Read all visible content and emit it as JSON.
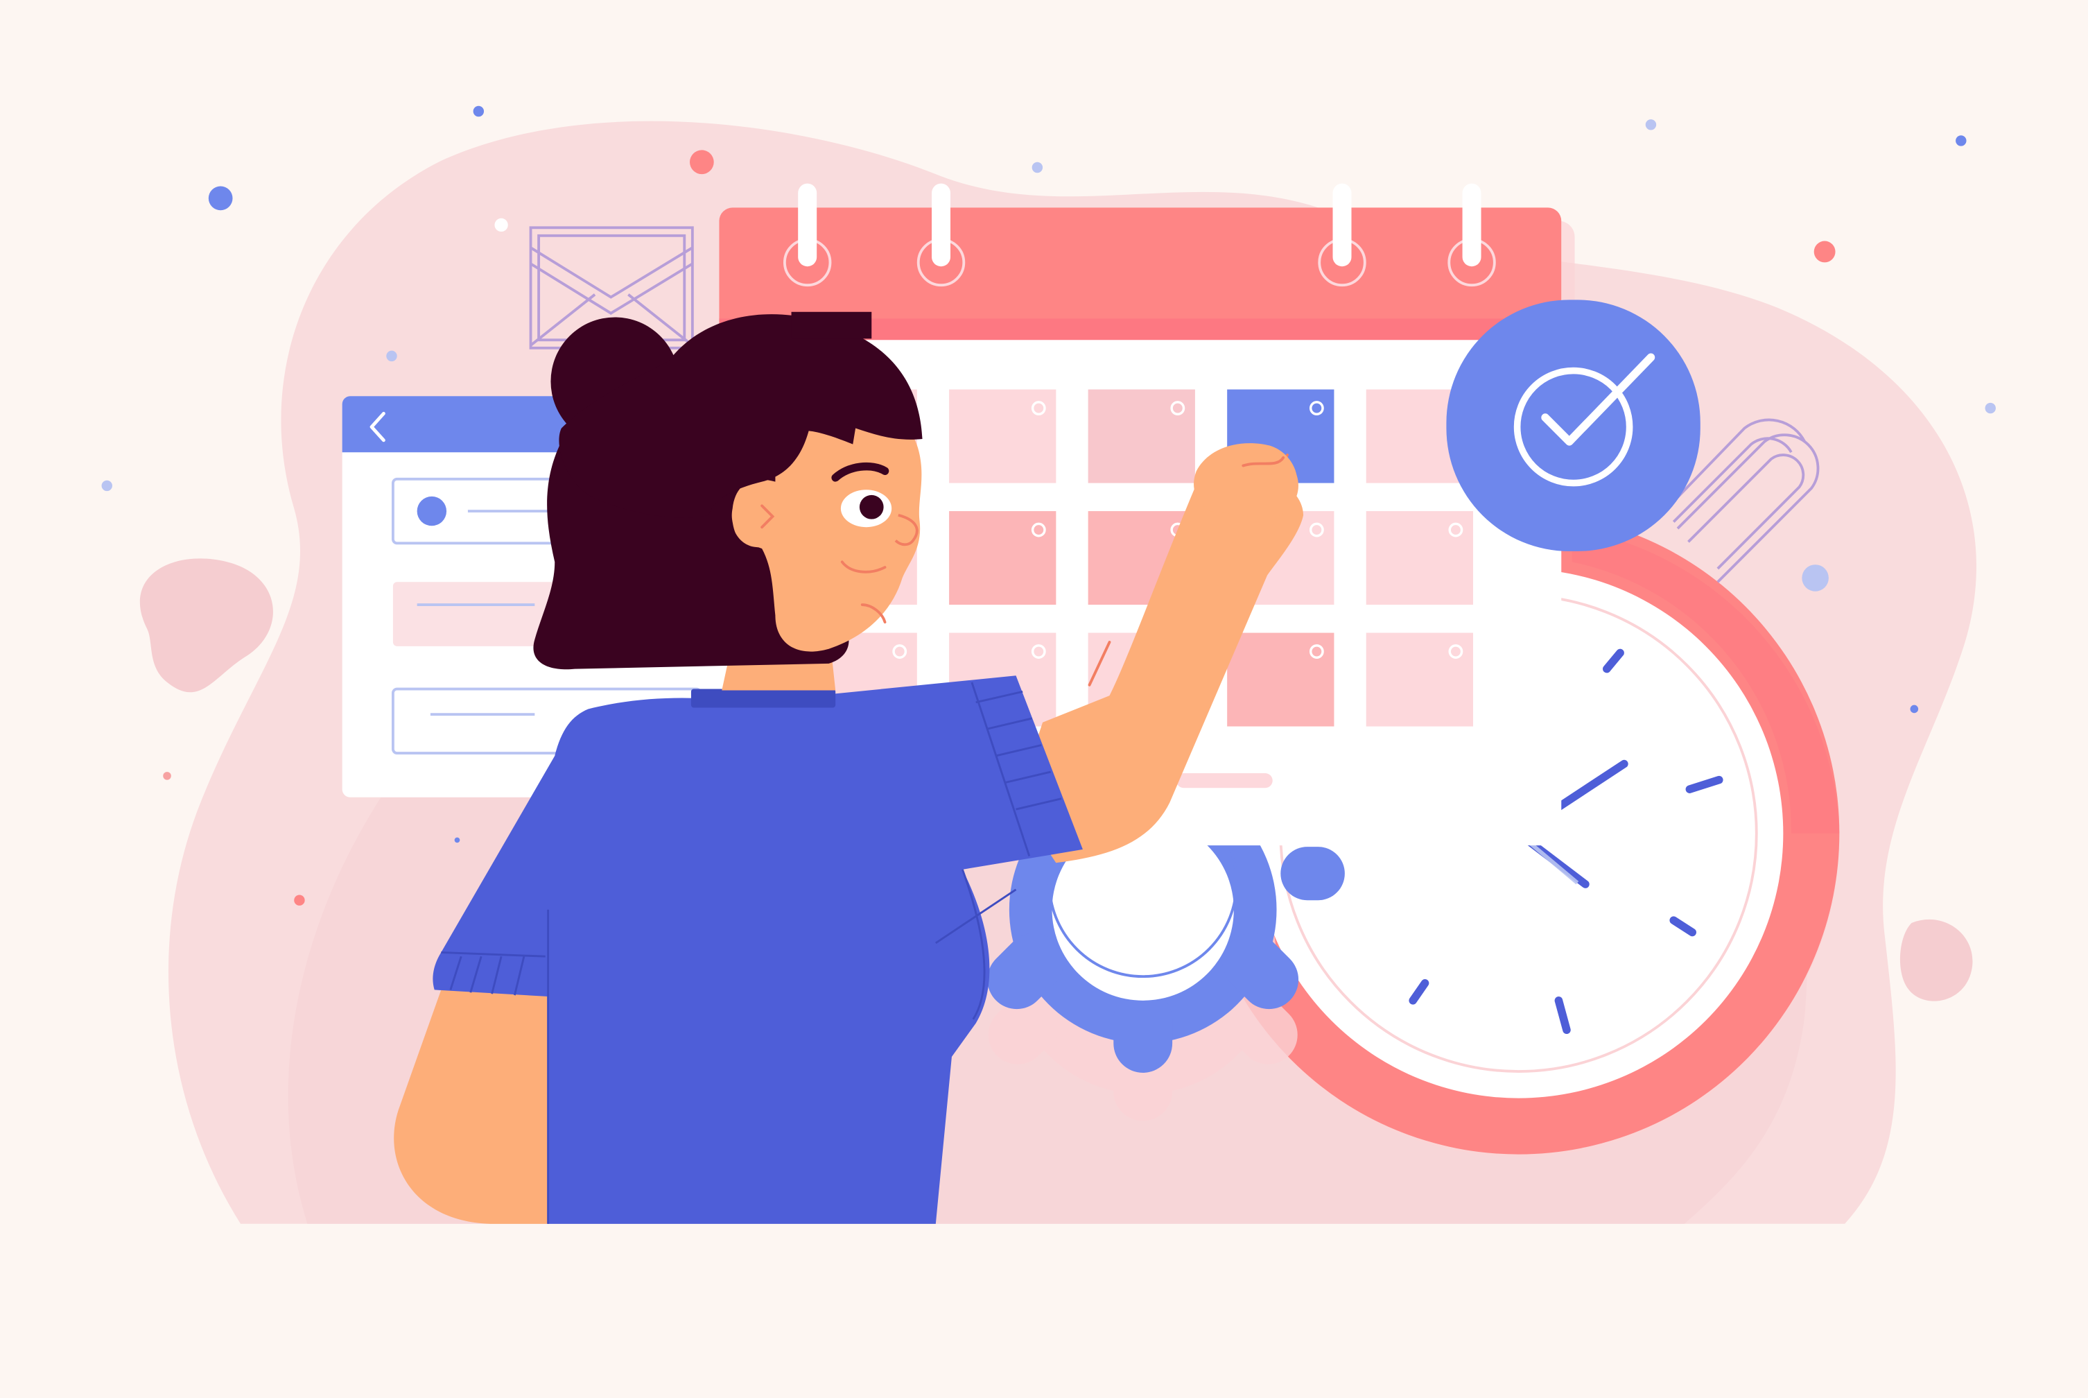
{
  "palette": {
    "background": "#fdf6f2",
    "blob": "#f9dcdd",
    "blob_dark": "#f5cdd0",
    "calendar_header": "#fe8585",
    "calendar_header_shadow": "#fd7882",
    "calendar_cell_light": "#fdd8dc",
    "calendar_cell_mid": "#f8c7cc",
    "calendar_cell_accent": "#fcb5b7",
    "selected_cell": "#6e87ec",
    "shirt": "#4e5ed8",
    "shirt_collar": "#3e4cc0",
    "skin": "#fdae79",
    "hair": "#3a0320",
    "clock_ring": "#fe8585",
    "gear": "#6e87ec",
    "check_badge": "#6e87ec",
    "window_header": "#6e87ec",
    "line_art": "#b79ed8"
  },
  "icons": {
    "back": "chevron-left-icon",
    "check": "check-circle-icon",
    "mail": "envelope-icon",
    "gear": "gear-icon",
    "clock": "clock-icon",
    "paperclip": "paperclip-icon"
  },
  "calendar": {
    "rows": 3,
    "columns": 4,
    "selected_cell": {
      "row": 1,
      "column": 3
    }
  }
}
